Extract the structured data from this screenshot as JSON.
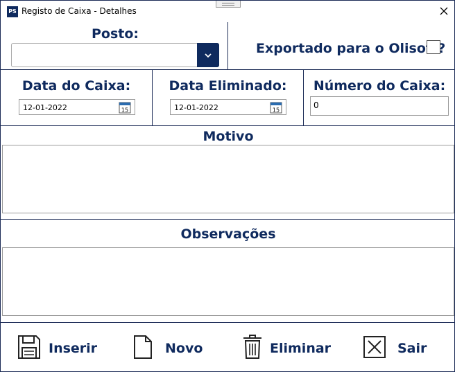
{
  "window": {
    "app_icon_text": "PS",
    "title": "Registo de Caixa - Detalhes"
  },
  "posto": {
    "label": "Posto:",
    "value": ""
  },
  "exportado": {
    "label": "Exportado para o Olisoft?",
    "checked": false
  },
  "data_caixa": {
    "label": "Data do Caixa:",
    "value": "12-01-2022"
  },
  "data_eliminado": {
    "label": "Data Eliminado:",
    "value": "12-01-2022"
  },
  "numero_caixa": {
    "label": "Número do Caixa:",
    "value": "0"
  },
  "motivo": {
    "label": "Motivo",
    "value": ""
  },
  "observacoes": {
    "label": "Observações",
    "value": ""
  },
  "actions": {
    "inserir": "Inserir",
    "novo": "Novo",
    "eliminar": "Eliminar",
    "sair": "Sair"
  },
  "calendar_day": "15",
  "colors": {
    "accent": "#0f2a5e",
    "border": "#1a2a55"
  }
}
